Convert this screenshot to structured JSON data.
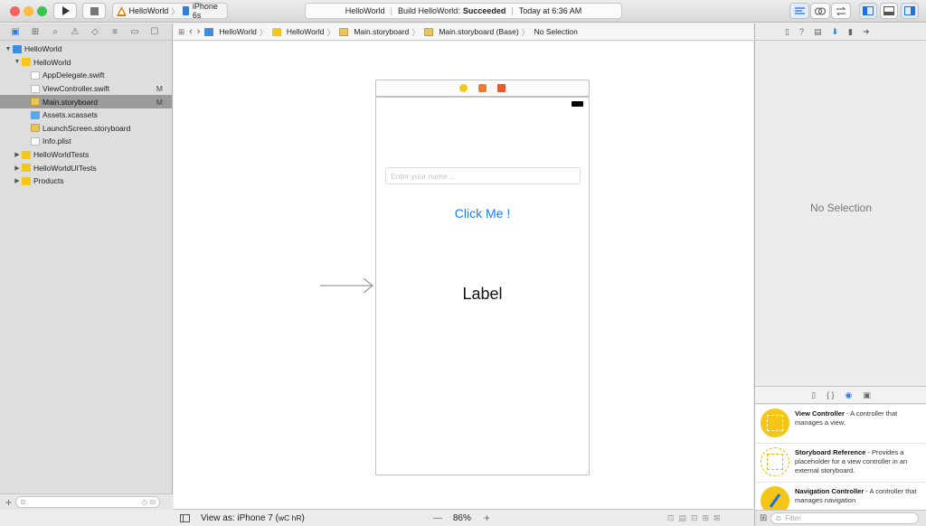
{
  "toolbar": {
    "scheme_target": "HelloWorld",
    "device": "iPhone 6s",
    "activity_project": "HelloWorld",
    "activity_status_prefix": "Build HelloWorld:",
    "activity_status": "Succeeded",
    "activity_time": "Today at 6:36 AM",
    "colors": {
      "close": "#fc605c",
      "minimize": "#fdbc40",
      "zoom": "#34c84a"
    }
  },
  "navigator": {
    "items": [
      {
        "label": "HelloWorld",
        "kind": "project",
        "indent": 0,
        "disclosure": "▼",
        "badge": ""
      },
      {
        "label": "HelloWorld",
        "kind": "folder",
        "indent": 1,
        "disclosure": "▼",
        "badge": ""
      },
      {
        "label": "AppDelegate.swift",
        "kind": "swift",
        "indent": 2,
        "disclosure": "",
        "badge": ""
      },
      {
        "label": "ViewController.swift",
        "kind": "swift",
        "indent": 2,
        "disclosure": "",
        "badge": "M"
      },
      {
        "label": "Main.storyboard",
        "kind": "storyboard",
        "indent": 2,
        "disclosure": "",
        "badge": "M",
        "selected": true
      },
      {
        "label": "Assets.xcassets",
        "kind": "assets",
        "indent": 2,
        "disclosure": "",
        "badge": ""
      },
      {
        "label": "LaunchScreen.storyboard",
        "kind": "storyboard",
        "indent": 2,
        "disclosure": "",
        "badge": ""
      },
      {
        "label": "Info.plist",
        "kind": "plist",
        "indent": 2,
        "disclosure": "",
        "badge": ""
      },
      {
        "label": "HelloWorldTests",
        "kind": "folder",
        "indent": 1,
        "disclosure": "▶",
        "badge": ""
      },
      {
        "label": "HelloWorldUITests",
        "kind": "folder",
        "indent": 1,
        "disclosure": "▶",
        "badge": ""
      },
      {
        "label": "Products",
        "kind": "folder",
        "indent": 1,
        "disclosure": "▶",
        "badge": ""
      }
    ]
  },
  "jumpbar": {
    "crumbs": [
      "HelloWorld",
      "HelloWorld",
      "Main.storyboard",
      "Main.storyboard (Base)",
      "No Selection"
    ]
  },
  "scene": {
    "textfield_placeholder": "Enter your name...",
    "button_title": "Click Me !",
    "label_text": "Label",
    "accent": "#1a7cf5"
  },
  "bottom": {
    "view_as_prefix": "View as: iPhone 7 (",
    "view_as_size": "wC hR",
    "view_as_suffix": ")",
    "zoom": "86%",
    "minus": "—",
    "plus": "+"
  },
  "utility": {
    "no_selection": "No Selection",
    "library": [
      {
        "title": "View Controller",
        "desc": " - A controller that manages a view."
      },
      {
        "title": "Storyboard Reference",
        "desc": " - Provides a placeholder for a view controller in an external storyboard."
      },
      {
        "title": "Navigation Controller",
        "desc": " - A controller that manages navigation"
      }
    ],
    "filter_placeholder": "Filter"
  }
}
